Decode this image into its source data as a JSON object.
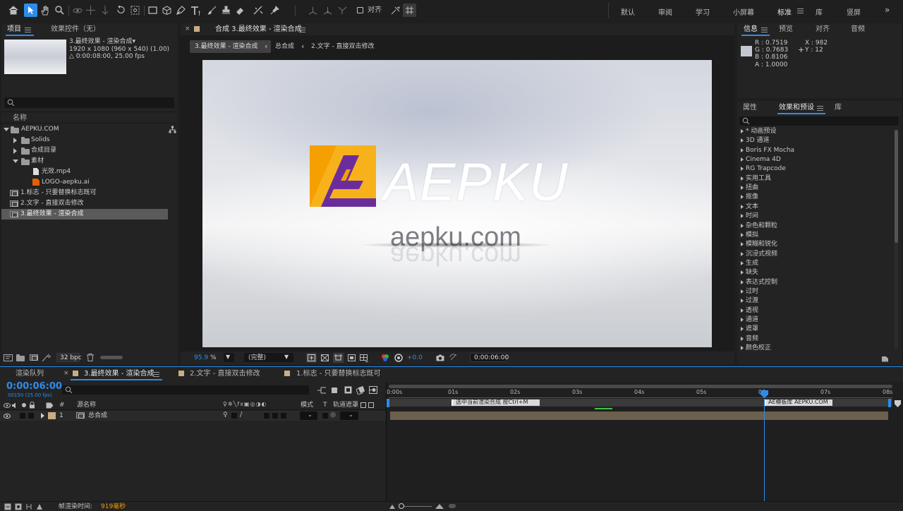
{
  "toolbar": {
    "align_label": "对齐",
    "workspaces": [
      "默认",
      "审阅",
      "学习",
      "小屏幕",
      "标准",
      "库",
      "竖屏"
    ],
    "active_workspace": "标准"
  },
  "project_panel": {
    "tab_project": "项目",
    "tab_effect_controls": "效果控件（无）",
    "thumb_name": "3.最终效果 - 渲染合成▾",
    "thumb_res": "1920 x 1080  (960 x 540) (1.00)",
    "thumb_dur": "△ 0:00:08:00, 25.00 fps",
    "search_placeholder": "",
    "col_name": "名称",
    "items": [
      {
        "label": "AEPKU.COM",
        "kind": "folder-open"
      },
      {
        "label": "Solids",
        "kind": "folder"
      },
      {
        "label": "合成目录",
        "kind": "folder"
      },
      {
        "label": "素材",
        "kind": "folder-open"
      },
      {
        "label": "光效.mp4",
        "kind": "file"
      },
      {
        "label": "LOGO-aepku.ai",
        "kind": "ai"
      },
      {
        "label": "1.标志 - 只要替换标志既可",
        "kind": "comp"
      },
      {
        "label": "2.文字 - 直接双击修改",
        "kind": "comp"
      },
      {
        "label": "3.最终效果 - 渲染合成",
        "kind": "comp"
      }
    ],
    "bpc": "32 bpc"
  },
  "comp_panel": {
    "tab_title": "合成 3.最终效果 - 渲染合成",
    "breadcrumb": [
      "3.最终效果 - 渲染合成",
      "总合成",
      "2.文字 - 直接双击修改"
    ],
    "logo_text": "AEPKU",
    "url_text": "aepku.com",
    "zoom": "95.9",
    "zoom_unit": "%",
    "resolution": "(完整)",
    "exposure": "+0.0",
    "timecode": "0:00:06:00"
  },
  "info_panel": {
    "tabs": [
      "信息",
      "预览",
      "对齐",
      "音频"
    ],
    "r": "R : 0.7519",
    "g": "G : 0.7683",
    "b": "B : 0.8106",
    "a": "A : 1.0000",
    "x": "X : 982",
    "y": "Y : 12",
    "swatch": "#c5c8d0"
  },
  "effects_panel": {
    "tabs": [
      "属性",
      "效果和预设",
      "库"
    ],
    "search_placeholder": "",
    "categories": [
      "* 动画预设",
      "3D 通道",
      "Boris FX Mocha",
      "Cinema 4D",
      "RG Trapcode",
      "实用工具",
      "扭曲",
      "抠像",
      "文本",
      "时间",
      "杂色和颗粒",
      "模拟",
      "模糊和锐化",
      "沉浸式视频",
      "生成",
      "缺失",
      "表达式控制",
      "过时",
      "过渡",
      "透视",
      "通道",
      "遮罩",
      "音频",
      "颜色校正"
    ]
  },
  "timeline": {
    "tabs": [
      "渲染队列",
      "3.最终效果 - 渲染合成",
      "2.文字 - 直接双击修改",
      "1.标志 - 只要替换标志既可"
    ],
    "timecode": "0:00:06:00",
    "frame_info": "00150 (25.00 fps)",
    "col_source": "源名称",
    "col_mode": "模式",
    "col_t": "T",
    "col_track": "轨道遮罩",
    "layer_num": "1",
    "layer_name": "总合成",
    "ruler": [
      "0:00s",
      "01s",
      "02s",
      "03s",
      "04s",
      "05s",
      "06s",
      "07s",
      "08s"
    ],
    "marker1": "选中当前渲染合成   按Ctrl+M",
    "marker2": "AE模板库  AEPKU.COM",
    "render_label": "帧渲染时间:",
    "render_value": "919毫秒"
  },
  "colors": {
    "accent_blue": "#2d8ceb",
    "logo_orange": "#f5a000",
    "logo_purple": "#6c2d9c",
    "layer_bar": "#6b604e",
    "comp_swatch": "#c9ad84"
  }
}
